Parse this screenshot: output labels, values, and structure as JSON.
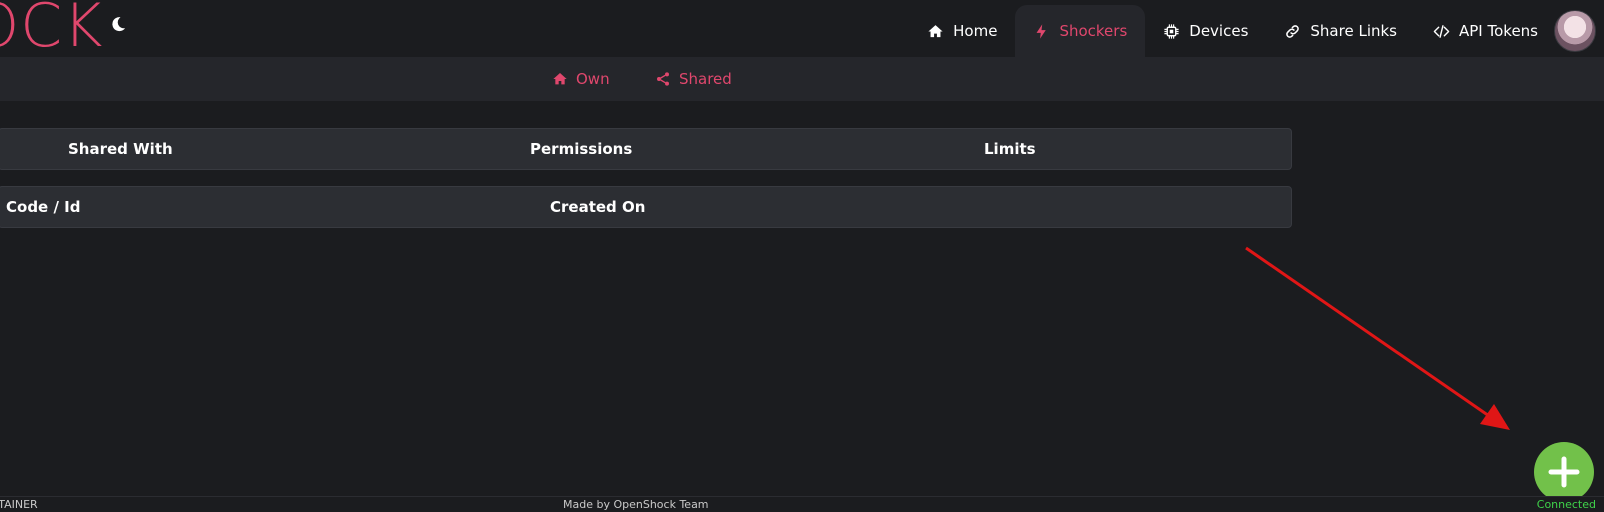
{
  "app": {
    "logo_text": "OCK"
  },
  "nav": {
    "items": [
      {
        "label": "Home",
        "icon": "home-icon"
      },
      {
        "label": "Shockers",
        "icon": "bolt-icon",
        "active": true
      },
      {
        "label": "Devices",
        "icon": "chip-icon"
      },
      {
        "label": "Share Links",
        "icon": "link-icon"
      },
      {
        "label": "API Tokens",
        "icon": "code-icon"
      }
    ]
  },
  "subtabs": [
    {
      "label": "Own",
      "icon": "home-icon"
    },
    {
      "label": "Shared",
      "icon": "share-icon"
    }
  ],
  "table1": {
    "headers": [
      "Shared With",
      "Permissions",
      "Limits"
    ]
  },
  "table2": {
    "headers": [
      "Code / Id",
      "Created On"
    ]
  },
  "footer": {
    "left": "NTAINER",
    "center": "Made by OpenShock Team",
    "right": "Connected"
  },
  "colors": {
    "accent": "#e0476d",
    "fab": "#72c14a",
    "status_connected": "#3fd24a",
    "annotation_arrow": "#e01616"
  }
}
